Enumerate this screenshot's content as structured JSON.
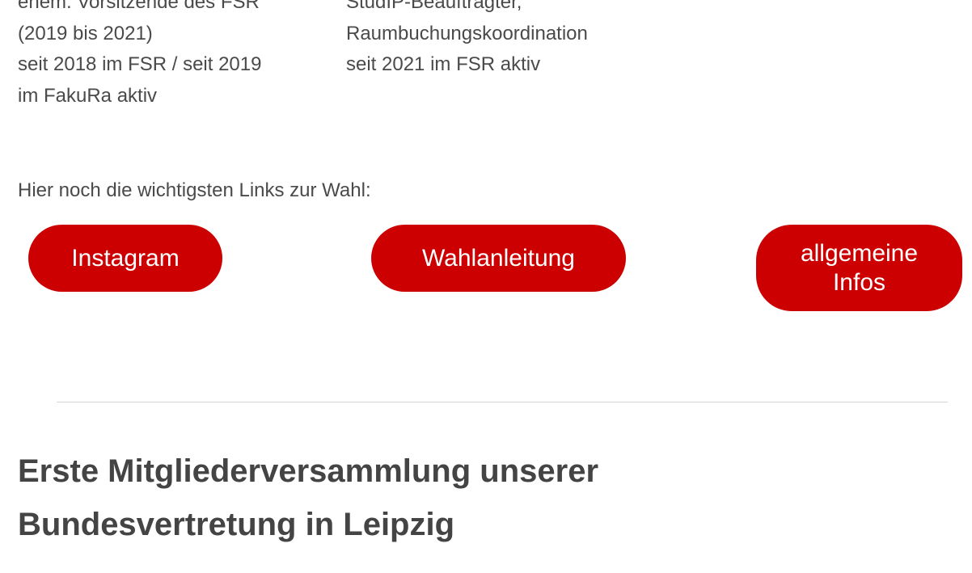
{
  "bio": {
    "left": [
      "ehem. Vorsitzende des FSR",
      "(2019 bis 2021)",
      "seit 2018 im FSR / seit 2019",
      "im FakuRa aktiv"
    ],
    "right": [
      "StudIP-Beauftragter,",
      "Raumbuchungskoordination",
      "seit 2021 im FSR aktiv"
    ]
  },
  "links": {
    "intro": "Hier noch die wichtigsten Links zur Wahl:",
    "instagram_label": "Instagram",
    "wahlanleitung_label": "Wahlanleitung",
    "infos_label": "allgemeine Infos"
  },
  "article": {
    "headline_line1": "Erste Mitgliederversammlung unserer",
    "headline_line2": "Bundesvertretung in Leipzig"
  },
  "colors": {
    "accent": "#cc0000",
    "text": "#444444",
    "divider": "#d6d6d6"
  }
}
